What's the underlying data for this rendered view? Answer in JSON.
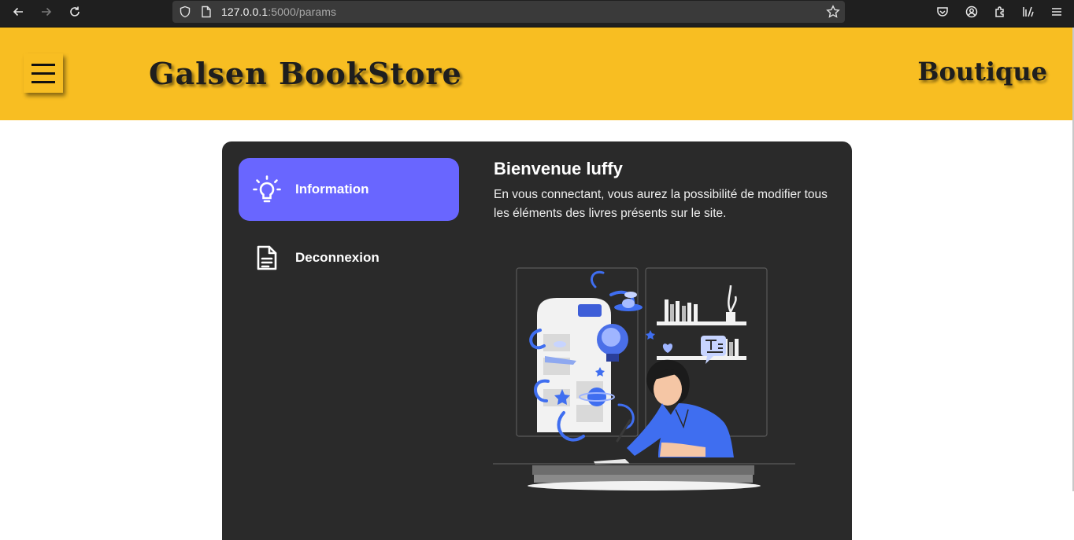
{
  "browser": {
    "url_host": "127.0.0.1",
    "url_path": ":5000/params"
  },
  "header": {
    "brand": "Galsen BookStore",
    "shop_label": "Boutique",
    "background_color": "#f8be22"
  },
  "sidebar": {
    "items": [
      {
        "label": "Information",
        "icon": "lightbulb-icon",
        "active": true
      },
      {
        "label": "Deconnexion",
        "icon": "document-icon",
        "active": false
      }
    ],
    "active_color": "#6966ff"
  },
  "main": {
    "title": "Bienvenue luffy",
    "description": "En vous connectant, vous aurez la possibilité de modifier tous les éléments des livres présents sur le site.",
    "illustration": "woman-writing-illustration"
  },
  "panel_color": "#2a2a2a"
}
